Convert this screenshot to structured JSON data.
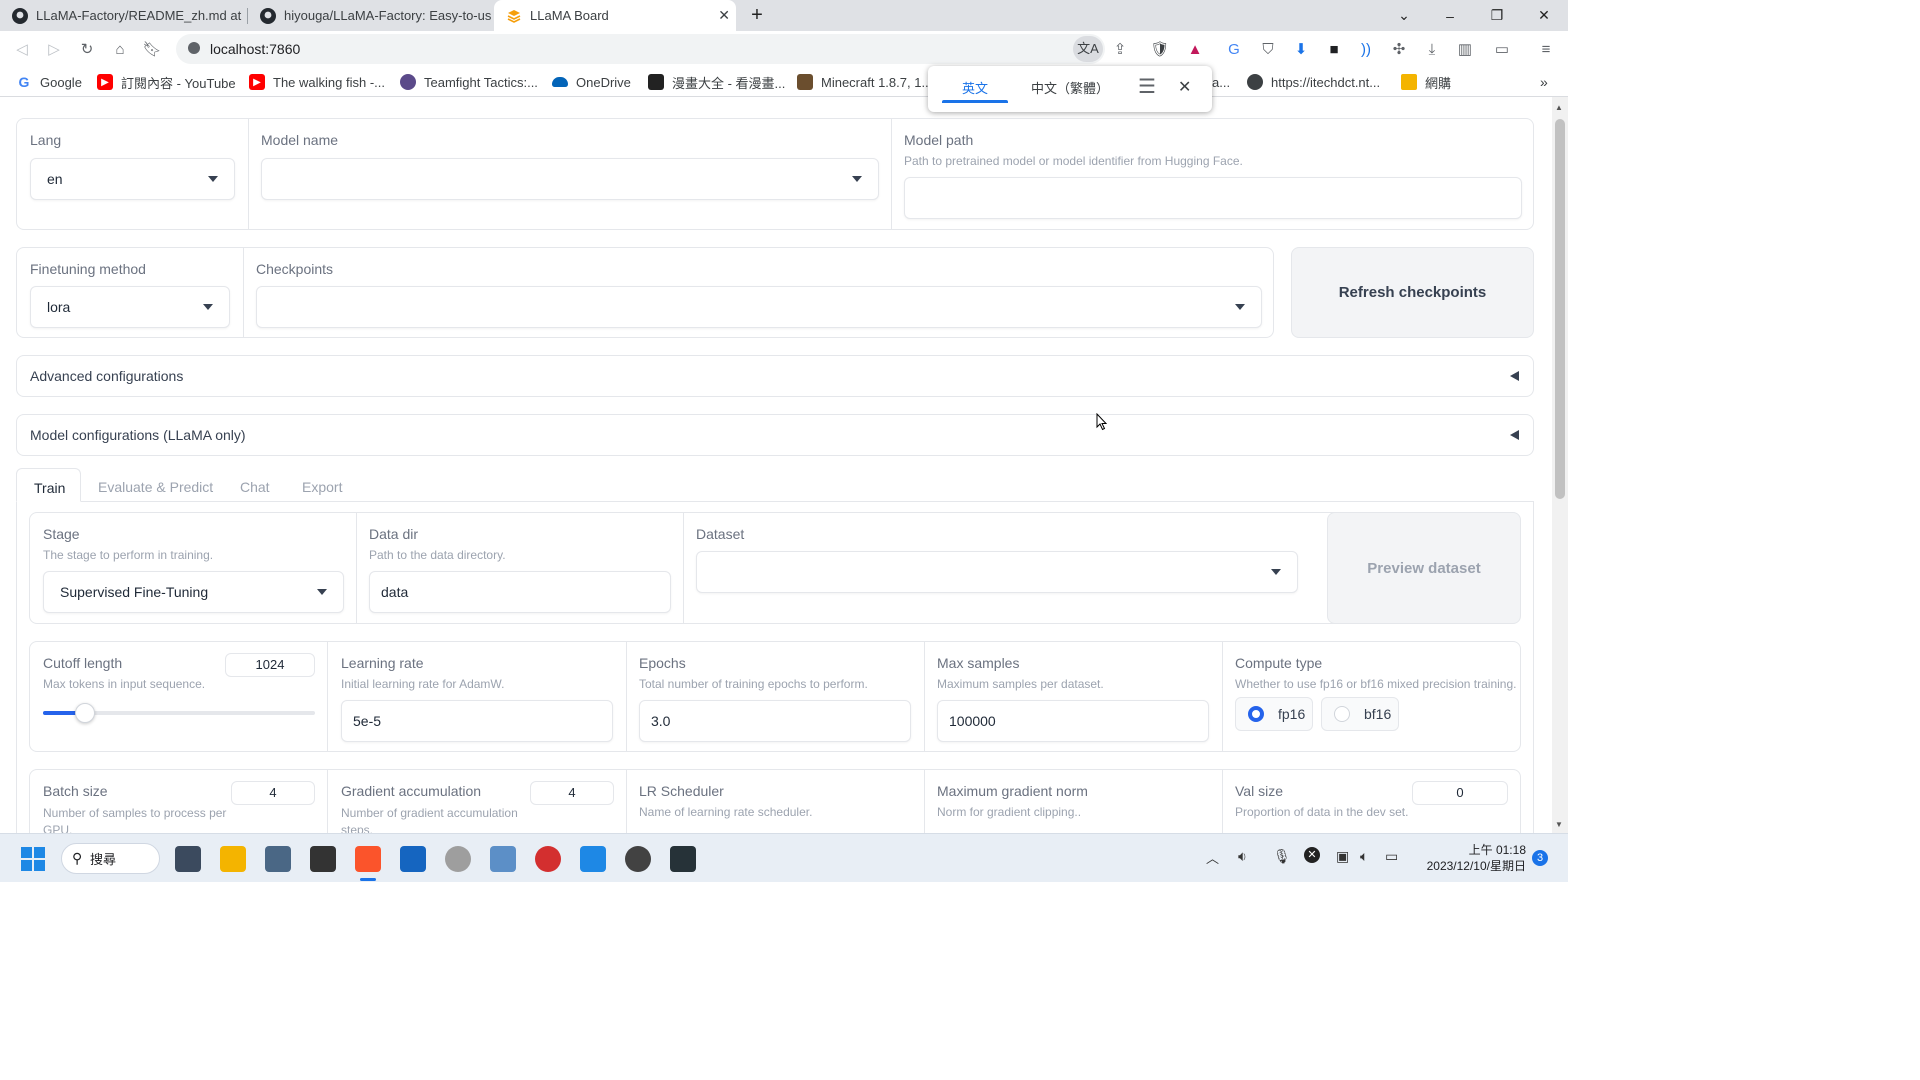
{
  "browser": {
    "tabs": [
      {
        "title": "LLaMA-Factory/README_zh.md at r",
        "active": false
      },
      {
        "title": "hiyouga/LLaMA-Factory: Easy-to-us",
        "active": false
      },
      {
        "title": "LLaMA Board",
        "active": true
      }
    ],
    "url": "localhost:7860",
    "bookmarks": [
      {
        "label": "Google",
        "icon": "google-icon",
        "color": "#4285f4"
      },
      {
        "label": "訂閱內容 - YouTube",
        "icon": "youtube-icon",
        "color": "#ff0000"
      },
      {
        "label": "The walking fish -...",
        "icon": "youtube-icon",
        "color": "#ff0000"
      },
      {
        "label": "Teamfight Tactics:...",
        "icon": "tft-icon",
        "color": "#5b4a8a"
      },
      {
        "label": "OneDrive",
        "icon": "onedrive-icon",
        "color": "#0364b8"
      },
      {
        "label": "漫畫大全 - 看漫畫...",
        "icon": "comic-icon",
        "color": "#222222"
      },
      {
        "label": "Minecraft 1.8.7, 1...",
        "icon": "minecraft-icon",
        "color": "#6b4e2e"
      },
      {
        "label": "a...",
        "icon": "",
        "color": ""
      },
      {
        "label": "https://itechdct.nt...",
        "icon": "globe-icon",
        "color": "#3c4043"
      },
      {
        "label": "網購",
        "icon": "folder-icon",
        "color": "#f4b400"
      }
    ],
    "translate_popup": {
      "tab1": "英文",
      "tab2": "中文（繁體）"
    }
  },
  "app": {
    "lang": {
      "label": "Lang",
      "value": "en"
    },
    "model_name": {
      "label": "Model name",
      "value": ""
    },
    "model_path": {
      "label": "Model path",
      "info": "Path to pretrained model or model identifier from Hugging Face.",
      "value": ""
    },
    "finetuning_method": {
      "label": "Finetuning method",
      "value": "lora"
    },
    "checkpoints": {
      "label": "Checkpoints",
      "value": ""
    },
    "refresh_button": "Refresh checkpoints",
    "advanced_config": "Advanced configurations",
    "model_config": "Model configurations (LLaMA only)",
    "tabs": [
      "Train",
      "Evaluate & Predict",
      "Chat",
      "Export"
    ],
    "stage": {
      "label": "Stage",
      "info": "The stage to perform in training.",
      "value": "Supervised Fine-Tuning"
    },
    "data_dir": {
      "label": "Data dir",
      "info": "Path to the data directory.",
      "value": "data"
    },
    "dataset": {
      "label": "Dataset",
      "value": ""
    },
    "preview_button": "Preview dataset",
    "cutoff_len": {
      "label": "Cutoff length",
      "info": "Max tokens in input sequence.",
      "value": "1024",
      "fraction": 0.155
    },
    "learning_rate": {
      "label": "Learning rate",
      "info": "Initial learning rate for AdamW.",
      "value": "5e-5"
    },
    "epochs": {
      "label": "Epochs",
      "info": "Total number of training epochs to perform.",
      "value": "3.0"
    },
    "max_samples": {
      "label": "Max samples",
      "info": "Maximum samples per dataset.",
      "value": "100000"
    },
    "compute_type": {
      "label": "Compute type",
      "info": "Whether to use fp16 or bf16 mixed precision training.",
      "options": [
        "fp16",
        "bf16"
      ],
      "selected": "fp16"
    },
    "batch_size": {
      "label": "Batch size",
      "info": "Number of samples to process per GPU.",
      "value": "4"
    },
    "grad_accum": {
      "label": "Gradient accumulation",
      "info": "Number of gradient accumulation steps.",
      "value": "4"
    },
    "lr_scheduler": {
      "label": "LR Scheduler",
      "info": "Name of learning rate scheduler."
    },
    "max_grad_norm": {
      "label": "Maximum gradient norm",
      "info": "Norm for gradient clipping.."
    },
    "val_size": {
      "label": "Val size",
      "info": "Proportion of data in the dev set.",
      "value": "0"
    }
  },
  "taskbar": {
    "search": "搜尋",
    "time": "上午 01:18",
    "date": "2023/12/10/星期日",
    "notifications": "3"
  }
}
